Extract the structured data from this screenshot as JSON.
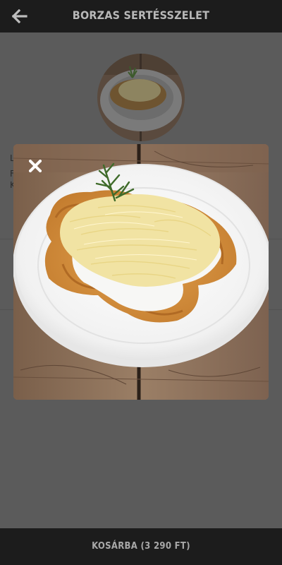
{
  "header": {
    "back_icon": "arrow-left-icon",
    "title": "BORZAS SERTÉSSZELET"
  },
  "underlay": {
    "line1": "L",
    "line2": "F",
    "line3": "K"
  },
  "modal": {
    "close_icon": "close-icon",
    "image_description": "Breaded pork cutlet topped with sour cream, grated cheese and a rosemary sprig on a white plate"
  },
  "footer": {
    "cart_label": "KOSÁRBA (3 290 FT)"
  },
  "colors": {
    "bar_bg": "#1c1c1c",
    "overlay_bg": "#5b5b5b",
    "bar_text": "#b8b8b8"
  }
}
